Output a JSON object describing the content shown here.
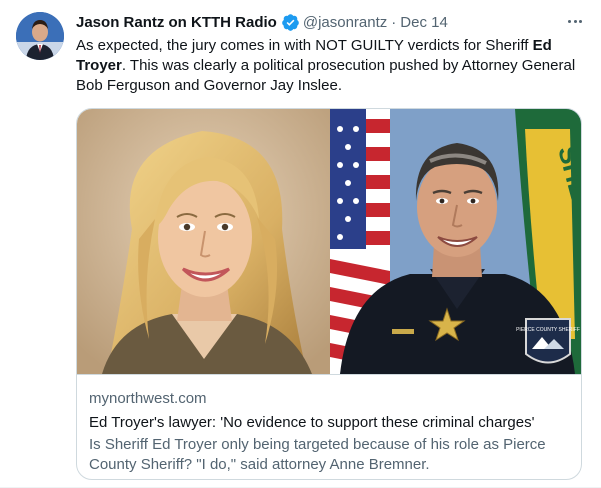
{
  "tweet": {
    "author": {
      "display_name": "Jason Rantz on KTTH Radio",
      "verified": true,
      "handle": "@jasonrantz",
      "separator": "·",
      "date": "Dec 14",
      "avatar_icon": "profile-avatar"
    },
    "more_icon": "ellipsis-icon",
    "text": {
      "part1": "As expected, the jury comes in with NOT GUILTY verdicts for Sheriff ",
      "bold": "Ed Troyer",
      "part2": ". This was clearly a political prosecution pushed by Attorney General Bob Ferguson and Governor Jay Inslee."
    },
    "link_card": {
      "domain": "mynorthwest.com",
      "title": "Ed Troyer's lawyer: 'No evidence to support these criminal charges'",
      "description": "Is Sheriff Ed Troyer only being targeted because of his role as Pierce County Sheriff? \"I do,\" said attorney Anne Bremner.",
      "image_left": "portrait-woman-blonde",
      "image_right": "portrait-sheriff-uniform",
      "flag_text": "SHERIFF",
      "patch_text": "PIERCE COUNTY SHERIFF"
    },
    "colors": {
      "verified_blue": "#1d9bf0",
      "secondary_text": "#536471",
      "primary_text": "#0f1419",
      "border": "#cfd9de"
    }
  }
}
